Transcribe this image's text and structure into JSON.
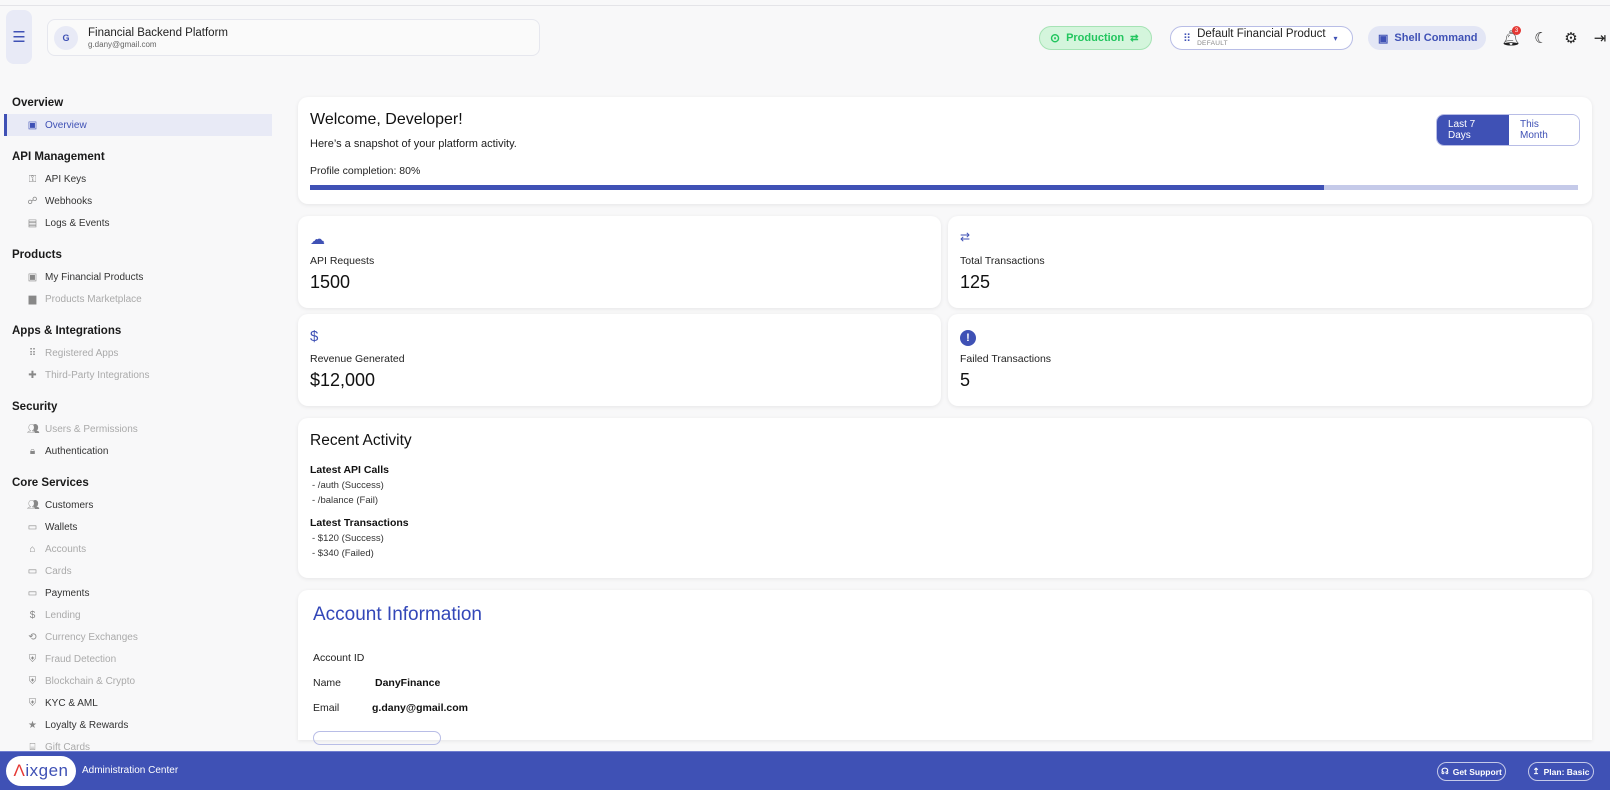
{
  "header": {
    "title": "Financial Backend Platform",
    "email": "g.dany@gmail.com",
    "avatar_letter": "G",
    "environment": "Production",
    "product_name": "Default Financial Product",
    "product_tag": "DEFAULT",
    "shell_label": "Shell Command",
    "notification_count": "3"
  },
  "sidebar": {
    "sections": [
      {
        "title": "Overview",
        "items": [
          {
            "label": "Overview",
            "icon": "dashboard-icon",
            "state": "active"
          }
        ]
      },
      {
        "title": "API Management",
        "items": [
          {
            "label": "API Keys",
            "icon": "key-icon",
            "state": "normal"
          },
          {
            "label": "Webhooks",
            "icon": "webhook-icon",
            "state": "normal"
          },
          {
            "label": "Logs & Events",
            "icon": "calendar-icon",
            "state": "normal"
          }
        ]
      },
      {
        "title": "Products",
        "items": [
          {
            "label": "My Financial Products",
            "icon": "product-icon",
            "state": "normal"
          },
          {
            "label": "Products Marketplace",
            "icon": "store-icon",
            "state": "dim"
          }
        ]
      },
      {
        "title": "Apps & Integrations",
        "items": [
          {
            "label": "Registered Apps",
            "icon": "grid-icon",
            "state": "dim"
          },
          {
            "label": "Third-Party Integrations",
            "icon": "puzzle-icon",
            "state": "dim"
          }
        ]
      },
      {
        "title": "Security",
        "items": [
          {
            "label": "Users & Permissions",
            "icon": "users-icon",
            "state": "dim"
          },
          {
            "label": "Authentication",
            "icon": "lock-icon",
            "state": "normal"
          }
        ]
      },
      {
        "title": "Core Services",
        "items": [
          {
            "label": "Customers",
            "icon": "users-icon",
            "state": "normal"
          },
          {
            "label": "Wallets",
            "icon": "wallet-icon",
            "state": "normal"
          },
          {
            "label": "Accounts",
            "icon": "bank-icon",
            "state": "dim"
          },
          {
            "label": "Cards",
            "icon": "card-icon",
            "state": "dim"
          },
          {
            "label": "Payments",
            "icon": "card-icon",
            "state": "normal"
          },
          {
            "label": "Lending",
            "icon": "dollar-circle-icon",
            "state": "dim"
          },
          {
            "label": "Currency Exchanges",
            "icon": "exchange-icon",
            "state": "dim"
          },
          {
            "label": "Fraud Detection",
            "icon": "shield-icon",
            "state": "dim"
          },
          {
            "label": "Blockchain & Crypto",
            "icon": "shield-icon",
            "state": "dim"
          },
          {
            "label": "KYC & AML",
            "icon": "shield-check-icon",
            "state": "normal"
          },
          {
            "label": "Loyalty & Rewards",
            "icon": "star-icon",
            "state": "normal"
          },
          {
            "label": "Gift Cards",
            "icon": "gift-icon",
            "state": "dim"
          }
        ]
      }
    ]
  },
  "welcome": {
    "title": "Welcome, Developer!",
    "subtitle": "Here’s a snapshot of your platform activity.",
    "profile_label": "Profile completion: 80%",
    "profile_completion_percent": 80,
    "range_options": [
      "Last 7 Days",
      "This Month"
    ],
    "range_selected": "Last 7 Days"
  },
  "stats": [
    {
      "label": "API Requests",
      "value": "1500",
      "icon": "cloud-icon"
    },
    {
      "label": "Total Transactions",
      "value": "125",
      "icon": "swap-icon"
    },
    {
      "label": "Revenue Generated",
      "value": "$12,000",
      "icon": "dollar-icon"
    },
    {
      "label": "Failed Transactions",
      "value": "5",
      "icon": "alert-icon"
    }
  ],
  "recent_activity": {
    "title": "Recent Activity",
    "api_calls_title": "Latest API Calls",
    "api_calls": [
      "- /auth (Success)",
      "- /balance (Fail)"
    ],
    "transactions_title": "Latest Transactions",
    "transactions": [
      "- $120 (Success)",
      "- $340 (Failed)"
    ]
  },
  "account": {
    "title": "Account Information",
    "id_label": "Account ID",
    "id_value": "",
    "name_label": "Name",
    "name_value": "DanyFinance",
    "email_label": "Email",
    "email_value": "g.dany@gmail.com"
  },
  "footer": {
    "logo": "Aixgen",
    "title": "Administration Center",
    "support_label": "Get Support",
    "plan_label": "Plan: Basic"
  },
  "colors": {
    "primary": "#3f51b5",
    "success": "#22c55e",
    "danger": "#e53935"
  }
}
